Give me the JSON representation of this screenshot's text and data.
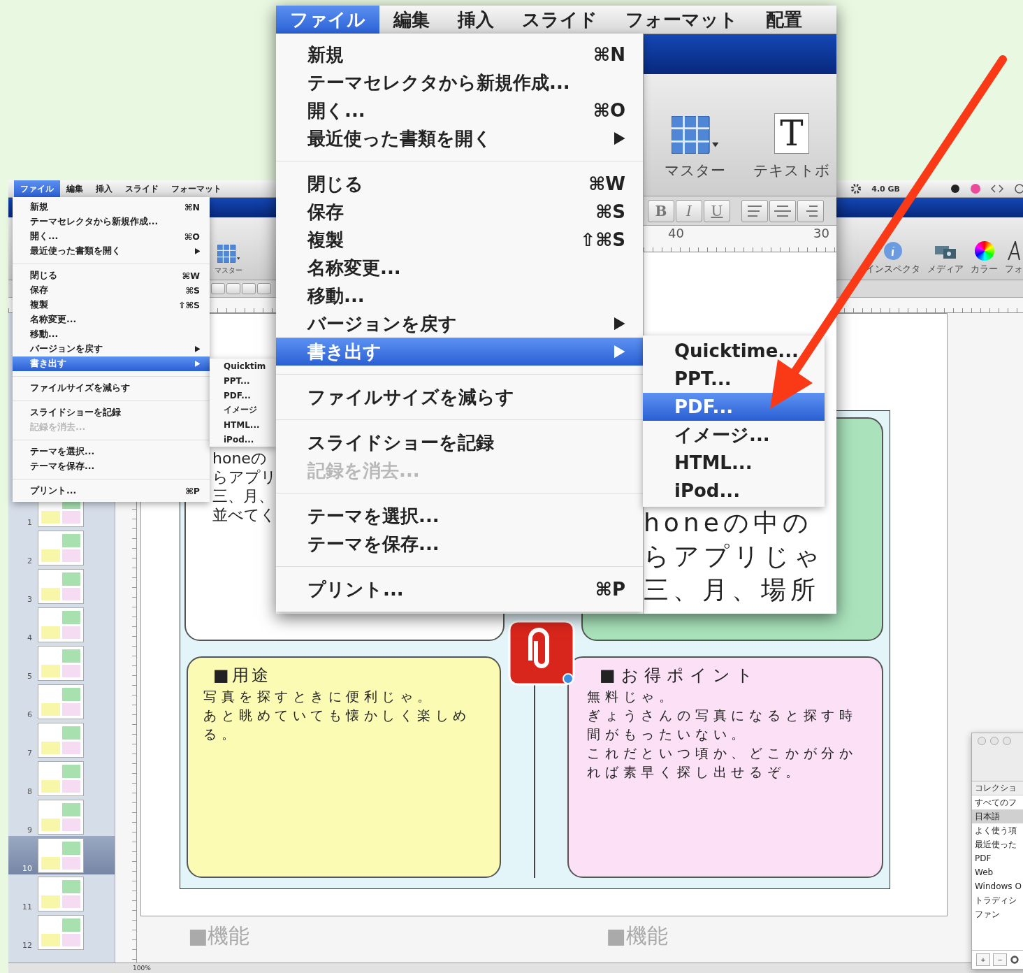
{
  "background_window": {
    "menu_bar": [
      {
        "label": "ファイル",
        "selected": true
      },
      {
        "label": "編集",
        "selected": false
      },
      {
        "label": "挿入",
        "selected": false
      },
      {
        "label": "スライド",
        "selected": false
      },
      {
        "label": "フォーマット",
        "selected": false
      }
    ],
    "memory": "4.0 GB",
    "toolbar_left": [
      {
        "label": "マスター",
        "kind": "master"
      }
    ],
    "toolbar_right": [
      {
        "label": "インスペクタ",
        "kind": "info"
      },
      {
        "label": "メディア",
        "kind": "media"
      },
      {
        "label": "カラー",
        "kind": "color"
      },
      {
        "label": "フォ",
        "kind": "font"
      }
    ],
    "file_menu": [
      {
        "kind": "item",
        "label": "新規",
        "shortcut": "⌘N",
        "submenu": false,
        "selected": false,
        "disabled": false
      },
      {
        "kind": "item",
        "label": "テーマセレクタから新規作成...",
        "submenu": false,
        "selected": false,
        "disabled": false
      },
      {
        "kind": "item",
        "label": "開く...",
        "shortcut": "⌘O",
        "submenu": false,
        "selected": false,
        "disabled": false
      },
      {
        "kind": "item",
        "label": "最近使った書類を開く",
        "submenu": true,
        "selected": false,
        "disabled": false
      },
      {
        "kind": "separator"
      },
      {
        "kind": "item",
        "label": "閉じる",
        "shortcut": "⌘W",
        "submenu": false,
        "selected": false,
        "disabled": false
      },
      {
        "kind": "item",
        "label": "保存",
        "shortcut": "⌘S",
        "submenu": false,
        "selected": false,
        "disabled": false
      },
      {
        "kind": "item",
        "label": "複製",
        "shortcut": "⇧⌘S",
        "submenu": false,
        "selected": false,
        "disabled": false
      },
      {
        "kind": "item",
        "label": "名称変更...",
        "submenu": false,
        "selected": false,
        "disabled": false
      },
      {
        "kind": "item",
        "label": "移動...",
        "submenu": false,
        "selected": false,
        "disabled": false
      },
      {
        "kind": "item",
        "label": "バージョンを戻す",
        "submenu": true,
        "selected": false,
        "disabled": false
      },
      {
        "kind": "item",
        "label": "書き出す",
        "submenu": true,
        "selected": true,
        "disabled": false
      },
      {
        "kind": "separator"
      },
      {
        "kind": "item",
        "label": "ファイルサイズを減らす",
        "submenu": false,
        "selected": false,
        "disabled": false
      },
      {
        "kind": "separator"
      },
      {
        "kind": "item",
        "label": "スライドショーを記録",
        "submenu": false,
        "selected": false,
        "disabled": false
      },
      {
        "kind": "item",
        "label": "記録を消去...",
        "submenu": false,
        "selected": false,
        "disabled": true
      },
      {
        "kind": "separator"
      },
      {
        "kind": "item",
        "label": "テーマを選択...",
        "submenu": false,
        "selected": false,
        "disabled": false
      },
      {
        "kind": "item",
        "label": "テーマを保存...",
        "submenu": false,
        "selected": false,
        "disabled": false
      },
      {
        "kind": "separator"
      },
      {
        "kind": "item",
        "label": "プリント...",
        "shortcut": "⌘P",
        "submenu": false,
        "selected": false,
        "disabled": false
      }
    ],
    "export_submenu": [
      {
        "label": "Quicktim",
        "selected": false
      },
      {
        "label": "PPT...",
        "selected": false
      },
      {
        "label": "PDF...",
        "selected": false
      },
      {
        "label": "イメージ",
        "selected": false
      },
      {
        "label": "HTML...",
        "selected": false
      },
      {
        "label": "iPod...",
        "selected": false
      }
    ],
    "slides": [
      {
        "number": "1",
        "selected": false
      },
      {
        "number": "2",
        "selected": false
      },
      {
        "number": "3",
        "selected": false
      },
      {
        "number": "4",
        "selected": false
      },
      {
        "number": "5",
        "selected": false
      },
      {
        "number": "6",
        "selected": false
      },
      {
        "number": "7",
        "selected": false
      },
      {
        "number": "8",
        "selected": false
      },
      {
        "number": "9",
        "selected": false
      },
      {
        "number": "10",
        "selected": true
      },
      {
        "number": "11",
        "selected": false
      },
      {
        "number": "12",
        "selected": false
      }
    ],
    "slide": {
      "top_left_lines": [
        "honeの",
        "らアプリ",
        "三、月、",
        "並べてく"
      ],
      "usage": {
        "heading": "■用途",
        "lines": [
          "写真を探すときに便利じゃ。",
          "あと眺めていても懐かしく楽しめ",
          "る。"
        ]
      },
      "benefits": {
        "heading": "■お得ポイント",
        "lines": [
          "無料じゃ。",
          "ぎょうさんの写真になると探す時",
          "間がもったいない。",
          "これだといつ頃か、どこかが分か",
          "れば素早く探し出せるぞ。"
        ]
      }
    },
    "next_slide_headings": [
      "■機能",
      "■機能"
    ],
    "zoom_level": "100%",
    "font_panel": {
      "header": "コレクショ",
      "collections": [
        {
          "label": "すべてのフ",
          "selected": false
        },
        {
          "label": "日本語",
          "selected": true
        },
        {
          "label": "よく使う項",
          "selected": false
        },
        {
          "label": "最近使った",
          "selected": false
        },
        {
          "label": "PDF",
          "selected": false
        },
        {
          "label": "Web",
          "selected": false
        },
        {
          "label": "Windows O",
          "selected": false
        },
        {
          "label": "トラディシ",
          "selected": false
        },
        {
          "label": "ファン",
          "selected": false
        }
      ],
      "buttons": [
        "+",
        "−"
      ]
    }
  },
  "magnified_view": {
    "menu_bar": [
      {
        "label": "ファイル",
        "selected": true
      },
      {
        "label": "編集",
        "selected": false
      },
      {
        "label": "挿入",
        "selected": false
      },
      {
        "label": "スライド",
        "selected": false
      },
      {
        "label": "フォーマット",
        "selected": false
      },
      {
        "label": "配置",
        "selected": false
      }
    ],
    "file_menu": [
      {
        "kind": "item",
        "label": "新規",
        "shortcut": "⌘N",
        "submenu": false,
        "selected": false,
        "disabled": false
      },
      {
        "kind": "item",
        "label": "テーマセレクタから新規作成...",
        "submenu": false,
        "selected": false,
        "disabled": false
      },
      {
        "kind": "item",
        "label": "開く...",
        "shortcut": "⌘O",
        "submenu": false,
        "selected": false,
        "disabled": false
      },
      {
        "kind": "item",
        "label": "最近使った書類を開く",
        "submenu": true,
        "selected": false,
        "disabled": false
      },
      {
        "kind": "separator"
      },
      {
        "kind": "item",
        "label": "閉じる",
        "shortcut": "⌘W",
        "submenu": false,
        "selected": false,
        "disabled": false
      },
      {
        "kind": "item",
        "label": "保存",
        "shortcut": "⌘S",
        "submenu": false,
        "selected": false,
        "disabled": false
      },
      {
        "kind": "item",
        "label": "複製",
        "shortcut": "⇧⌘S",
        "submenu": false,
        "selected": false,
        "disabled": false
      },
      {
        "kind": "item",
        "label": "名称変更...",
        "submenu": false,
        "selected": false,
        "disabled": false
      },
      {
        "kind": "item",
        "label": "移動...",
        "submenu": false,
        "selected": false,
        "disabled": false
      },
      {
        "kind": "item",
        "label": "バージョンを戻す",
        "submenu": true,
        "selected": false,
        "disabled": false
      },
      {
        "kind": "item",
        "label": "書き出す",
        "submenu": true,
        "selected": true,
        "disabled": false
      },
      {
        "kind": "separator"
      },
      {
        "kind": "item",
        "label": "ファイルサイズを減らす",
        "submenu": false,
        "selected": false,
        "disabled": false
      },
      {
        "kind": "separator"
      },
      {
        "kind": "item",
        "label": "スライドショーを記録",
        "submenu": false,
        "selected": false,
        "disabled": false
      },
      {
        "kind": "item",
        "label": "記録を消去...",
        "submenu": false,
        "selected": false,
        "disabled": true
      },
      {
        "kind": "separator"
      },
      {
        "kind": "item",
        "label": "テーマを選択...",
        "submenu": false,
        "selected": false,
        "disabled": false
      },
      {
        "kind": "item",
        "label": "テーマを保存...",
        "submenu": false,
        "selected": false,
        "disabled": false
      },
      {
        "kind": "separator"
      },
      {
        "kind": "item",
        "label": "プリント...",
        "shortcut": "⌘P",
        "submenu": false,
        "selected": false,
        "disabled": false
      }
    ],
    "export_submenu": [
      {
        "label": "Quicktime...",
        "selected": false
      },
      {
        "label": "PPT...",
        "selected": false
      },
      {
        "label": "PDF...",
        "selected": true
      },
      {
        "label": "イメージ...",
        "selected": false
      },
      {
        "label": "HTML...",
        "selected": false
      },
      {
        "label": "iPod...",
        "selected": false
      }
    ],
    "toolbar": [
      {
        "label": "マスター",
        "kind": "master"
      },
      {
        "label": "テキストボ",
        "kind": "textbox",
        "glyph": "T"
      }
    ],
    "format_buttons": [
      {
        "kind": "style",
        "label": "B"
      },
      {
        "kind": "style",
        "label": "I"
      },
      {
        "kind": "style",
        "label": "U"
      },
      {
        "kind": "left"
      },
      {
        "kind": "center"
      },
      {
        "kind": "right"
      }
    ],
    "ruler_marks": [
      "40",
      "30"
    ],
    "slide_lines": [
      "honeの中の",
      "らアプリじゃ",
      "三、月、場所"
    ]
  }
}
